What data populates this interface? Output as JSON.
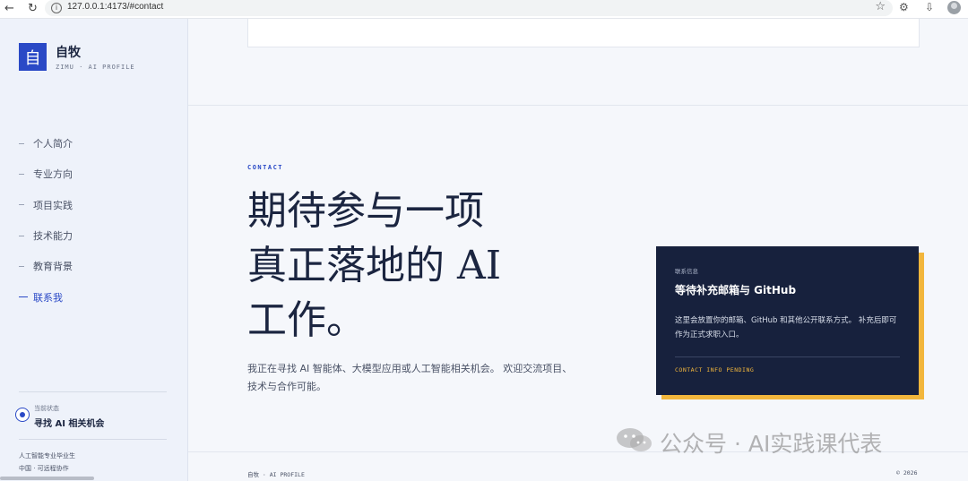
{
  "browser": {
    "url": "127.0.0.1:4173/#contact",
    "back_icon": "←",
    "reload_icon": "↻",
    "star_icon": "☆",
    "extensions_icon": "⚙",
    "downloads_icon": "⇩"
  },
  "sidebar": {
    "logo_char": "自",
    "brand_title": "自牧",
    "brand_subtitle": "ZIMU · AI PROFILE",
    "nav": [
      {
        "label": "个人简介",
        "active": false
      },
      {
        "label": "专业方向",
        "active": false
      },
      {
        "label": "项目实践",
        "active": false
      },
      {
        "label": "技术能力",
        "active": false
      },
      {
        "label": "教育背景",
        "active": false
      },
      {
        "label": "联系我",
        "active": true
      }
    ],
    "status_label": "当前状态",
    "status_value": "寻找 AI 相关机会",
    "footer_line1": "人工智能专业毕业生",
    "footer_line2": "中国 · 可远程协作"
  },
  "main": {
    "eyebrow": "CONTACT",
    "headline_lines": [
      "期待参与一项",
      "真正落地的 AI",
      "工作。"
    ],
    "lead": "我正在寻找 AI 智能体、大模型应用或人工智能相关机会。 欢迎交流项目、技术与合作可能。",
    "contact_card": {
      "label": "联系信息",
      "title": "等待补充邮箱与 GitHub",
      "description": "这里会放置你的邮箱、GitHub 和其他公开联系方式。 补充后即可作为正式求职入口。",
      "code": "CONTACT INFO PENDING"
    },
    "footer_left": "自牧 · AI PROFILE",
    "footer_right": "© 2026"
  },
  "watermark": {
    "text": "公众号 · AI实践课代表"
  },
  "colors": {
    "accent": "#2a49c6",
    "card_bg": "#17213d",
    "card_shadow": "#f2b63c",
    "sidebar_bg": "#eef2fa"
  }
}
